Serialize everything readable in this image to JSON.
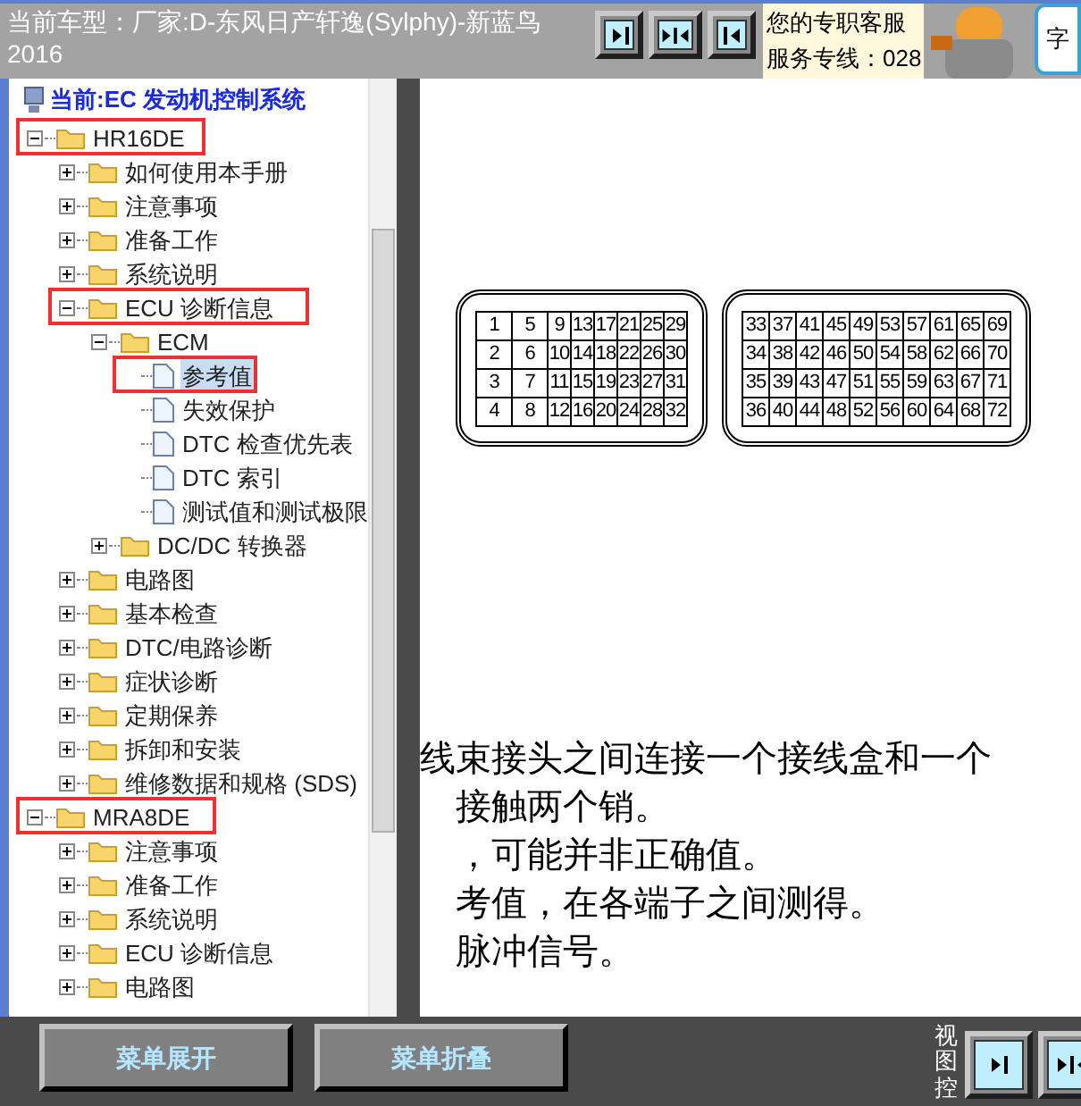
{
  "header": {
    "vehicle": "当前车型：厂家:D-东风日产轩逸(Sylphy)-新蓝鸟 2016",
    "service_lines": [
      "您的专职客服",
      "服务专线：028"
    ],
    "corner_text": "字"
  },
  "tree": {
    "title": "当前:EC 发动机控制系统",
    "items": [
      {
        "label": "HR16DE",
        "kind": "folder",
        "expanded": true,
        "selected": false,
        "highlighted": true,
        "children": [
          {
            "label": "如何使用本手册",
            "kind": "folder",
            "expanded": false,
            "selected": false,
            "highlighted": false
          },
          {
            "label": "注意事项",
            "kind": "folder",
            "expanded": false,
            "selected": false,
            "highlighted": false
          },
          {
            "label": "准备工作",
            "kind": "folder",
            "expanded": false,
            "selected": false,
            "highlighted": false
          },
          {
            "label": "系统说明",
            "kind": "folder",
            "expanded": false,
            "selected": false,
            "highlighted": false
          },
          {
            "label": "ECU 诊断信息",
            "kind": "folder",
            "expanded": true,
            "selected": false,
            "highlighted": true,
            "children": [
              {
                "label": "ECM",
                "kind": "folder",
                "expanded": true,
                "selected": false,
                "highlighted": false,
                "children": [
                  {
                    "label": "参考值",
                    "kind": "document",
                    "selected": true,
                    "highlighted": true
                  },
                  {
                    "label": "失效保护",
                    "kind": "document",
                    "selected": false,
                    "highlighted": false
                  },
                  {
                    "label": "DTC 检查优先表",
                    "kind": "document",
                    "selected": false,
                    "highlighted": false
                  },
                  {
                    "label": "DTC 索引",
                    "kind": "document",
                    "selected": false,
                    "highlighted": false
                  },
                  {
                    "label": "测试值和测试极限",
                    "kind": "document",
                    "selected": false,
                    "highlighted": false
                  }
                ]
              },
              {
                "label": "DC/DC 转换器",
                "kind": "folder",
                "expanded": false,
                "selected": false,
                "highlighted": false
              }
            ]
          },
          {
            "label": "电路图",
            "kind": "folder",
            "expanded": false,
            "selected": false,
            "highlighted": false
          },
          {
            "label": "基本检查",
            "kind": "folder",
            "expanded": false,
            "selected": false,
            "highlighted": false
          },
          {
            "label": "DTC/电路诊断",
            "kind": "folder",
            "expanded": false,
            "selected": false,
            "highlighted": false
          },
          {
            "label": "症状诊断",
            "kind": "folder",
            "expanded": false,
            "selected": false,
            "highlighted": false
          },
          {
            "label": "定期保养",
            "kind": "folder",
            "expanded": false,
            "selected": false,
            "highlighted": false
          },
          {
            "label": "拆卸和安装",
            "kind": "folder",
            "expanded": false,
            "selected": false,
            "highlighted": false
          },
          {
            "label": "维修数据和规格 (SDS)",
            "kind": "folder",
            "expanded": false,
            "selected": false,
            "highlighted": false
          }
        ]
      },
      {
        "label": "MRA8DE",
        "kind": "folder",
        "expanded": true,
        "selected": false,
        "highlighted": true,
        "children": [
          {
            "label": "注意事项",
            "kind": "folder",
            "expanded": false,
            "selected": false,
            "highlighted": false
          },
          {
            "label": "准备工作",
            "kind": "folder",
            "expanded": false,
            "selected": false,
            "highlighted": false
          },
          {
            "label": "系统说明",
            "kind": "folder",
            "expanded": false,
            "selected": false,
            "highlighted": false
          },
          {
            "label": "ECU 诊断信息",
            "kind": "folder",
            "expanded": false,
            "selected": false,
            "highlighted": false
          },
          {
            "label": "电路图",
            "kind": "folder",
            "expanded": false,
            "selected": false,
            "highlighted": false
          }
        ]
      }
    ]
  },
  "document": {
    "connectors": [
      {
        "rows": [
          [
            "1",
            "5",
            "9",
            "13",
            "17",
            "21",
            "25",
            "29"
          ],
          [
            "2",
            "6",
            "10",
            "14",
            "18",
            "22",
            "26",
            "30"
          ],
          [
            "3",
            "7",
            "11",
            "15",
            "19",
            "23",
            "27",
            "31"
          ],
          [
            "4",
            "8",
            "12",
            "16",
            "20",
            "24",
            "28",
            "32"
          ]
        ]
      },
      {
        "rows": [
          [
            "33",
            "37",
            "41",
            "45",
            "49",
            "53",
            "57",
            "61",
            "65",
            "69"
          ],
          [
            "34",
            "38",
            "42",
            "46",
            "50",
            "54",
            "58",
            "62",
            "66",
            "70"
          ],
          [
            "35",
            "39",
            "43",
            "47",
            "51",
            "55",
            "59",
            "63",
            "67",
            "71"
          ],
          [
            "36",
            "40",
            "44",
            "48",
            "52",
            "56",
            "60",
            "64",
            "68",
            "72"
          ]
        ]
      }
    ],
    "lines": [
      "线束接头之间连接一个接线盒和一个",
      "接触两个销。",
      "，可能并非正确值。",
      "考值，在各端子之间测得。",
      "脉冲信号。"
    ]
  },
  "footer": {
    "buttons": [
      "菜单展开",
      "菜单折叠"
    ],
    "view_label": "视图控"
  }
}
